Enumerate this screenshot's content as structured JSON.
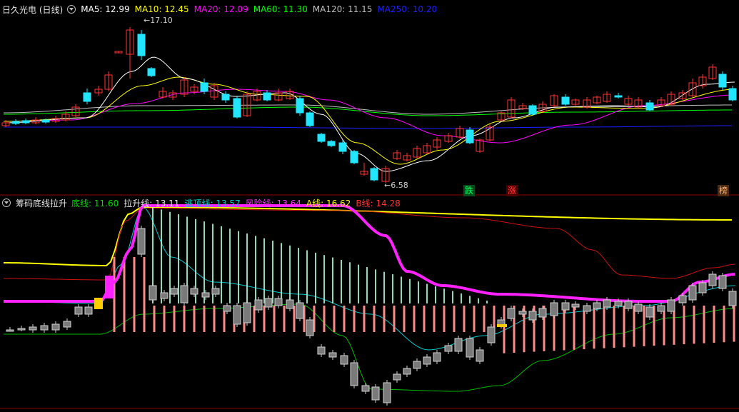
{
  "panel1": {
    "title": "日久光电 (日线)",
    "ma": [
      {
        "label": "MA5: 12.99",
        "color": "#ffffff"
      },
      {
        "label": "MA10: 12.45",
        "color": "#ffff00"
      },
      {
        "label": "MA20: 12.09",
        "color": "#ff00ff"
      },
      {
        "label": "MA60: 11.30",
        "color": "#00ff00"
      },
      {
        "label": "MA120: 11.15",
        "color": "#bfbfbf"
      },
      {
        "label": "MA250: 10.20",
        "color": "#1e1eff"
      }
    ],
    "high_label": "17.10",
    "low_label": "6.58",
    "signals": [
      {
        "text": "跌",
        "color": "#00ff66",
        "bg": "#004d1a"
      },
      {
        "text": "涨",
        "color": "#ff4040",
        "bg": "#4d0000"
      },
      {
        "text": "榜",
        "color": "#ffb070",
        "bg": "#4d2a10"
      }
    ]
  },
  "panel2": {
    "title": "筹码底线拉升",
    "lines": [
      {
        "label": "底线: 11.60",
        "color": "#00dd00"
      },
      {
        "label": "拉升线: 13.11",
        "color": "#e6e6e6"
      },
      {
        "label": "逃顶线: 13.57",
        "color": "#00cccc"
      },
      {
        "label": "风险线: 13.64",
        "color": "#ff33ff"
      },
      {
        "label": "A线: 16.62",
        "color": "#ffff00"
      },
      {
        "label": "B线: 14.28",
        "color": "#ff3333"
      }
    ]
  },
  "colors": {
    "up": "#ff3333",
    "down": "#22e6ff",
    "bg": "#000000",
    "divider": "#8b0000"
  }
}
